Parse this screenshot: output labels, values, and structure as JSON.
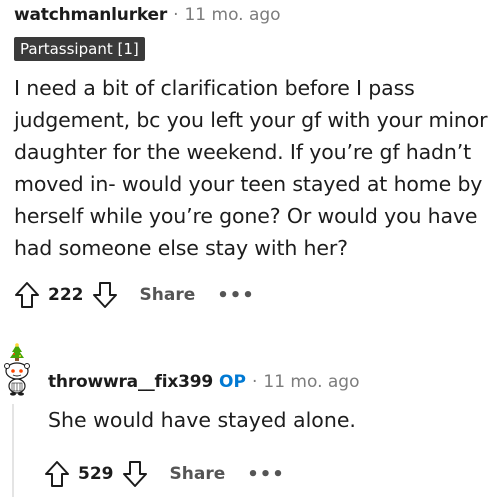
{
  "comment1": {
    "username": "watchmanlurker",
    "separator": "·",
    "time": "11 mo. ago",
    "flair": "Partassipant [1]",
    "body_lines": [
      "I need a bit of clarification before I pass",
      "judgement, bc you left your gf with your minor",
      "daughter for the weekend. If you’re gf hadn’t",
      "moved in- would your teen stayed at home by",
      "herself while you’re gone? Or would you have",
      "had someone else stay with her?"
    ],
    "votes": "222",
    "share_label": "Share",
    "more_label": "•••"
  },
  "comment2": {
    "username": "throwwra__fix399",
    "op_badge": "OP",
    "separator": "·",
    "time": "11 mo. ago",
    "body": "She would have stayed alone.",
    "votes": "529",
    "share_label": "Share",
    "more_label": "•••"
  },
  "colors": {
    "text": "#1c1c1c",
    "muted": "#7c7c7c",
    "op_blue": "#0079d3",
    "flair_bg": "#3a3a3a"
  },
  "icons": {
    "upvote": "upvote-arrow-icon",
    "downvote": "downvote-arrow-icon",
    "avatar": "snoo-avatar-icon"
  }
}
